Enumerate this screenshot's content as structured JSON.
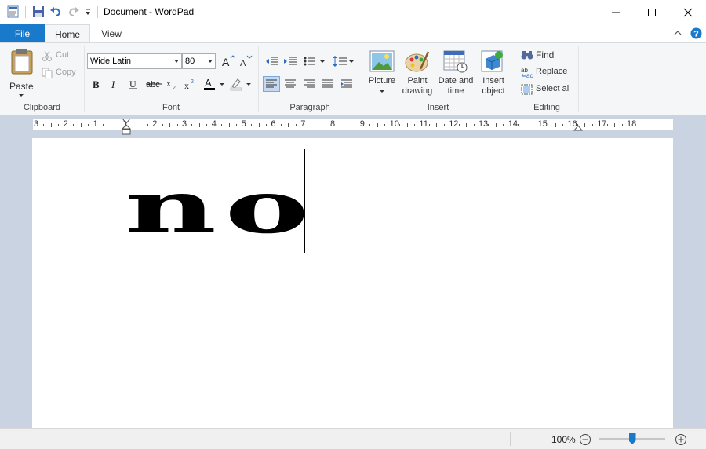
{
  "window": {
    "title": "Document - WordPad",
    "qat_icons": [
      "wordpad-app-icon",
      "save-icon",
      "undo-icon",
      "redo-icon",
      "customize-qat-icon"
    ]
  },
  "tabs": {
    "file": "File",
    "home": "Home",
    "view": "View"
  },
  "clipboard": {
    "group_label": "Clipboard",
    "paste": "Paste",
    "cut": "Cut",
    "copy": "Copy"
  },
  "font": {
    "group_label": "Font",
    "family": "Wide Latin",
    "size": "80"
  },
  "paragraph": {
    "group_label": "Paragraph"
  },
  "insert": {
    "group_label": "Insert",
    "picture": "Picture",
    "paint_drawing_1": "Paint",
    "paint_drawing_2": "drawing",
    "date_time_1": "Date and",
    "date_time_2": "time",
    "insert_object_1": "Insert",
    "insert_object_2": "object"
  },
  "editing": {
    "group_label": "Editing",
    "find": "Find",
    "replace": "Replace",
    "select_all": "Select all"
  },
  "ruler": {
    "numbers": [
      "3",
      "2",
      "1",
      "1",
      "2",
      "3",
      "4",
      "5",
      "6",
      "7",
      "8",
      "9",
      "10",
      "11",
      "12",
      "13",
      "14",
      "15",
      "16",
      "17",
      "18"
    ]
  },
  "document": {
    "text": "no"
  },
  "status": {
    "zoom": "100%",
    "zoom_fraction": 0.5
  },
  "colors": {
    "file_tab": "#1979ca",
    "ribbon_bg": "#f5f6f7",
    "workspace_bg": "#c9d3e2",
    "accent_blue": "#2b6cc4"
  }
}
